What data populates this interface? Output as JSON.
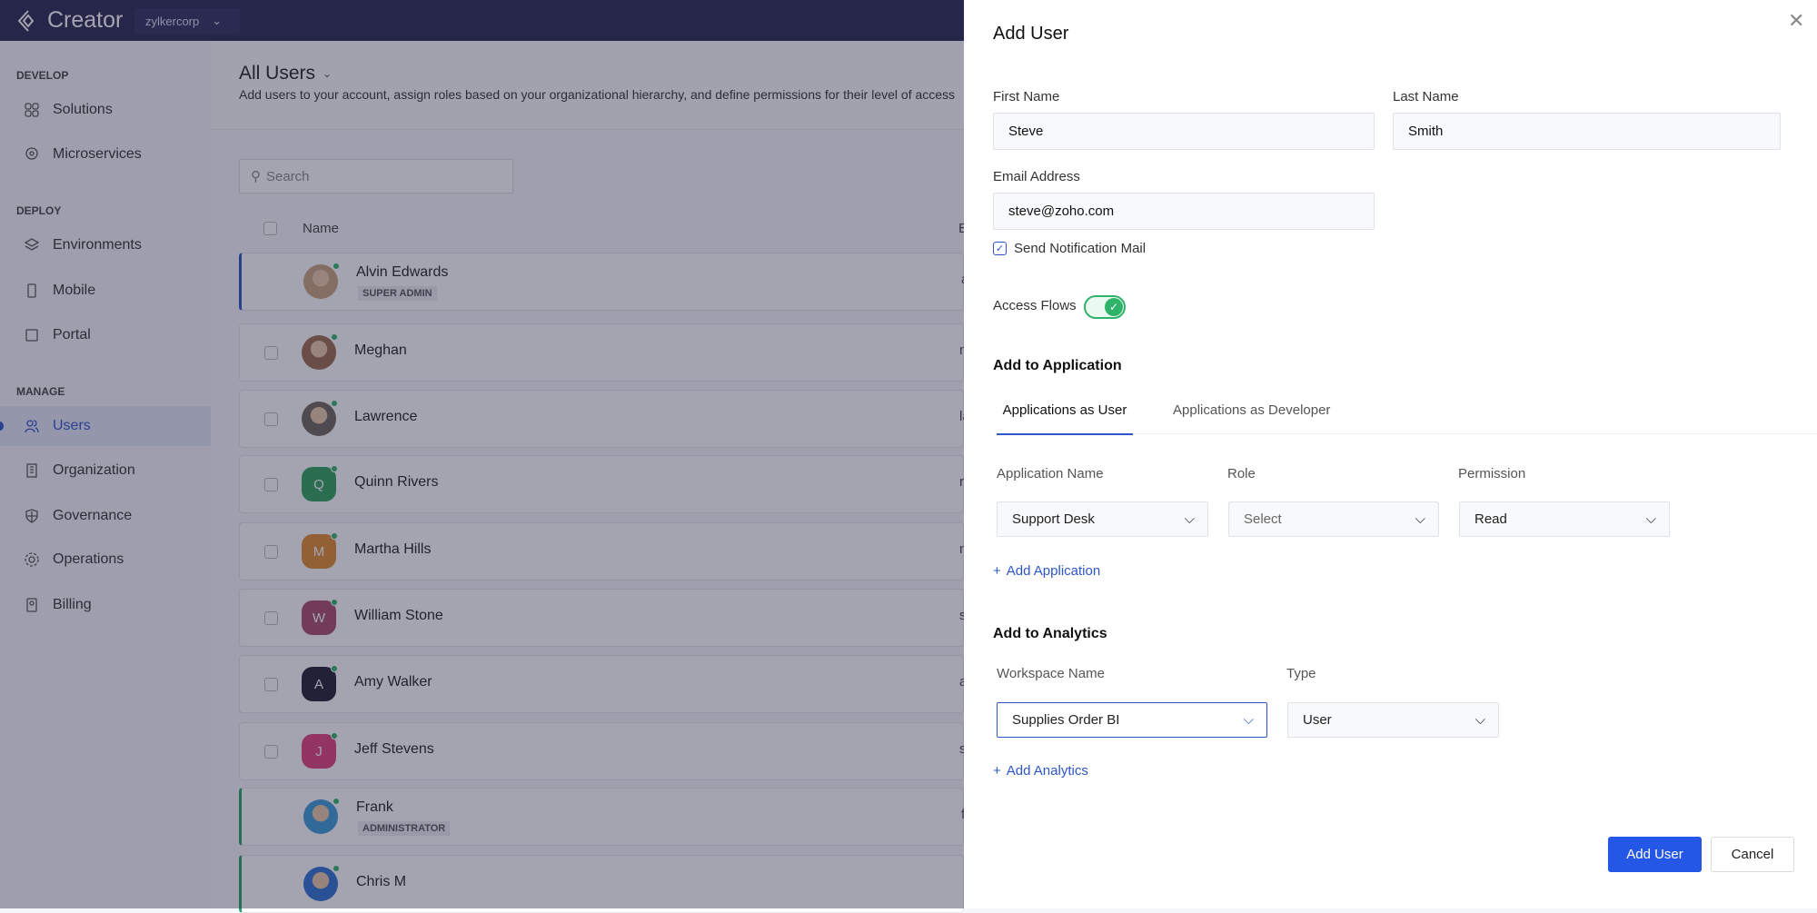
{
  "topbar": {
    "app_name": "Creator",
    "org": "zylkercorp"
  },
  "sidebar": {
    "sections": [
      "DEVELOP",
      "DEPLOY",
      "MANAGE"
    ],
    "items": [
      {
        "label": "Solutions",
        "icon": "grid-icon"
      },
      {
        "label": "Microservices",
        "icon": "location-icon"
      },
      {
        "label": "Environments",
        "icon": "layers-icon"
      },
      {
        "label": "Mobile",
        "icon": "mobile-icon"
      },
      {
        "label": "Portal",
        "icon": "portal-icon"
      },
      {
        "label": "Users",
        "icon": "users-icon",
        "active": true
      },
      {
        "label": "Organization",
        "icon": "building-icon"
      },
      {
        "label": "Governance",
        "icon": "shield-icon"
      },
      {
        "label": "Operations",
        "icon": "gear-icon"
      },
      {
        "label": "Billing",
        "icon": "bill-icon"
      }
    ]
  },
  "main": {
    "title": "All Users",
    "description": "Add users to your account, assign roles based on your organizational hierarchy, and define permissions for their level of access",
    "search_placeholder": "Search",
    "columns": [
      "Name",
      "E"
    ],
    "users": [
      {
        "name": "Alvin Edwards",
        "badge": "SUPER ADMIN",
        "email": "a",
        "avatar": "photo",
        "color": "#c9a27a"
      },
      {
        "name": "Meghan",
        "email": "m",
        "avatar": "photo",
        "color": "#9b6a4a"
      },
      {
        "name": "Lawrence",
        "email": "la",
        "avatar": "photo",
        "color": "#6d625a"
      },
      {
        "name": "Quinn Rivers",
        "email": "ri",
        "avatar": "Q",
        "color": "#2ea05a"
      },
      {
        "name": "Martha Hills",
        "email": "m",
        "avatar": "M",
        "color": "#e08a2c"
      },
      {
        "name": "William Stone",
        "email": "s",
        "avatar": "W",
        "color": "#a84a6a"
      },
      {
        "name": "Amy Walker",
        "email": "a",
        "avatar": "A",
        "color": "#1e2030"
      },
      {
        "name": "Jeff Stevens",
        "email": "s",
        "avatar": "J",
        "color": "#e0407a"
      },
      {
        "name": "Frank",
        "badge": "ADMINISTRATOR",
        "email": "fr",
        "avatar": "photo",
        "color": "#3a9ad8"
      },
      {
        "name": "Chris M",
        "email": "",
        "avatar": "photo",
        "color": "#2e70d0"
      }
    ]
  },
  "panel": {
    "title": "Add User",
    "first_name_label": "First Name",
    "first_name": "Steve",
    "last_name_label": "Last Name",
    "last_name": "Smith",
    "email_label": "Email Address",
    "email": "steve@zoho.com",
    "notify_label": "Send Notification Mail",
    "notify_checked": true,
    "access_flows_label": "Access Flows",
    "access_flows_on": true,
    "add_app_heading": "Add to Application",
    "tabs": [
      "Applications as User",
      "Applications as Developer"
    ],
    "app_cols": [
      "Application Name",
      "Role",
      "Permission"
    ],
    "app_row": [
      "Support Desk",
      "Select",
      "Read"
    ],
    "add_application": "Add Application",
    "analytics_heading": "Add to Analytics",
    "analytics_cols": [
      "Workspace Name",
      "Type"
    ],
    "analytics_row": [
      "Supplies Order BI",
      "User"
    ],
    "add_analytics": "Add Analytics",
    "submit": "Add User",
    "cancel": "Cancel",
    "accent": "#2457e6"
  }
}
